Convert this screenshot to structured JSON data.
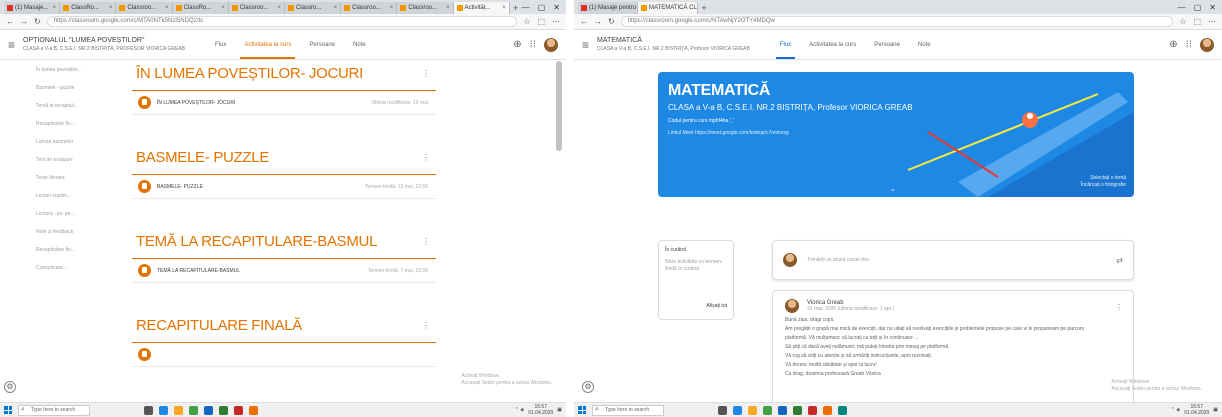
{
  "left": {
    "tabs": [
      {
        "label": "(1) Masaje...",
        "fav": "yt"
      },
      {
        "label": "ClassRo...",
        "fav": "cl"
      },
      {
        "label": "Classroo...",
        "fav": "cl"
      },
      {
        "label": "ClassRo...",
        "fav": "cl"
      },
      {
        "label": "Classroo...",
        "fav": "cl"
      },
      {
        "label": "Classro...",
        "fav": "cl"
      },
      {
        "label": "Classroo...",
        "fav": "cl"
      },
      {
        "label": "Classroo...",
        "fav": "cl"
      },
      {
        "label": "Activităț...",
        "fav": "cl",
        "active": true
      }
    ],
    "url": "https://classroom.google.com/c/MTA0NTk5NzI5NDQ2/tc",
    "course_title": "OPȚIONALUL \"LUMEA POVEȘTILOR\"",
    "course_subtitle": "CLASA a V-a B, C.S.E.I. NR.2 BISTRIȚA, PROFESOR VIORICA GREAB",
    "nav": [
      "Flux",
      "Activitatea la curs",
      "Persoane",
      "Note"
    ],
    "active_nav": 1,
    "topics": [
      "În lumea poveștilor...",
      "Basmele - puzzle",
      "Temă la recapitul...",
      "Recapitulare fin...",
      "Lumea basmelor",
      "Test de evaluare",
      "Texte literare",
      "Lecturi suplim...",
      "Lectura - joc pe...",
      "Note și feedback",
      "Recapitulare fin...",
      "Comunicare..."
    ],
    "sections": [
      {
        "title": "ÎN LUMEA POVEȘTILOR- JOCURI",
        "item": "ÎN LUMEA POVEȘTILOR- JOCURI",
        "date": "Ultima modificare: 19 mai"
      },
      {
        "title": "BASMELE- PUZZLE",
        "item": "BASMELE- PUZZLE",
        "date": "Termen-limită: 13 mai, 23:59"
      },
      {
        "title": "TEMĂ LA RECAPITULARE-BASMUL",
        "item": "TEMĂ LA RECAPITULARE-BASMUL",
        "date": "Termen-limită: 7 mai, 23:59"
      },
      {
        "title": "RECAPITULARE FINALĂ",
        "item": "",
        "date": ""
      }
    ],
    "activate": [
      "Activați Windows",
      "Accesați Setări pentru a activa Windows."
    ]
  },
  "right": {
    "tabs": [
      {
        "label": "(1) Masaje pentru ...",
        "fav": "yt"
      },
      {
        "label": "MATEMATICĂ CLASA a V-a B",
        "fav": "cl",
        "active": true
      }
    ],
    "url": "https://classroom.google.com/c/NTAwNjY2OTY4MDQw",
    "course_title": "MATEMATICĂ",
    "course_subtitle": "CLASA a V-a B, C.S.E.I. NR.2 BISTRIȚA, Profesor VIORICA GREAB",
    "nav": [
      "Flux",
      "Activitatea la curs",
      "Persoane",
      "Note"
    ],
    "active_nav": 0,
    "banner": {
      "title": "MATEMATICĂ",
      "subtitle": "CLASA a V-a B, C.S.E.I. NR.2 BISTRIȚA, Profesor VIORICA GREAB",
      "class_code": "Codul pentru curs   mphf4ha  ⛶",
      "meet_link": "Linkul Meet   https://meet.google.com/lookup/c7nnmvxg",
      "theme_links": [
        "Selectați o temă",
        "Încărcați o fotografie"
      ]
    },
    "upcoming": {
      "title": "În curând",
      "text": "Nicio activitate cu termen-limită în curând",
      "link": "Afișați tot"
    },
    "announce_placeholder": "Trimiteți un anunț clasei dvs.",
    "post": {
      "author": "Viorica Greab",
      "date": "31 mar. 2020 (ultima modificare: 1 apr.)",
      "lines": [
        "Bună ziua, dragi copii,",
        "Am pregătit o grupă mai mică de exerciții, dar nu uitați să rezolvați exercițiile și problemele propuse pe care vi le propuneam pe parcurs",
        "platformă. Vă mulțumesc că lucrați cu toții și în continuare ...",
        "Să știți că dacă aveți nelămuriri, mă puteți întreba prin mesaj pe platformă.",
        "Vă rog să citiți cu atenție și să urmăriți instrucțiunile, apoi rezolvați.",
        "Vă doresc multă sănătate și spor la lucru!",
        "Cu drag, doamna profesoară Greab Viorica"
      ]
    },
    "activate": [
      "Activați Windows",
      "Accesați Setări pentru a activa Windows."
    ]
  },
  "taskbar": {
    "search": "Type here to search",
    "time": "15:57",
    "date": "01.04.2020"
  }
}
